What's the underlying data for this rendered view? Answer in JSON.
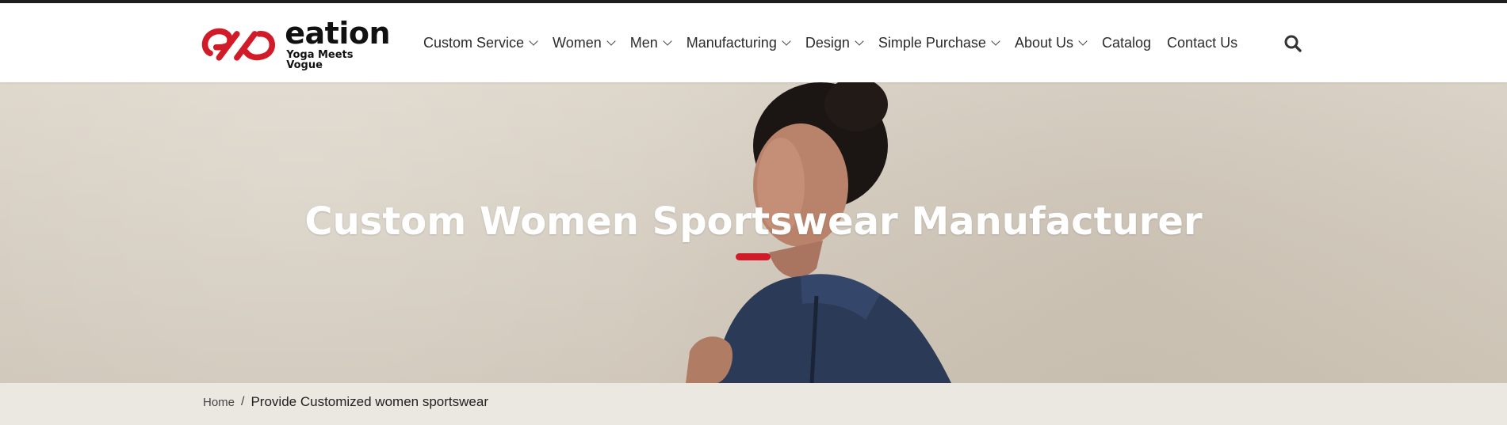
{
  "header": {
    "logo_name": "eation",
    "logo_tagline": "Yoga Meets Vogue",
    "brand_color": "#d21b28",
    "nav": [
      {
        "label": "Custom Service",
        "has_dropdown": true
      },
      {
        "label": "Women",
        "has_dropdown": true
      },
      {
        "label": "Men",
        "has_dropdown": true
      },
      {
        "label": "Manufacturing",
        "has_dropdown": true
      },
      {
        "label": "Design",
        "has_dropdown": true
      },
      {
        "label": "Simple Purchase",
        "has_dropdown": true
      },
      {
        "label": "About Us",
        "has_dropdown": true
      },
      {
        "label": "Catalog",
        "has_dropdown": false
      },
      {
        "label": "Contact Us",
        "has_dropdown": false
      }
    ],
    "search_icon": "search-icon"
  },
  "hero": {
    "title": "Custom Women Sportswear Manufacturer",
    "accent_color": "#d21b28"
  },
  "breadcrumb": {
    "home": "Home",
    "separator": "/",
    "current": "Provide Customized women sportswear"
  }
}
